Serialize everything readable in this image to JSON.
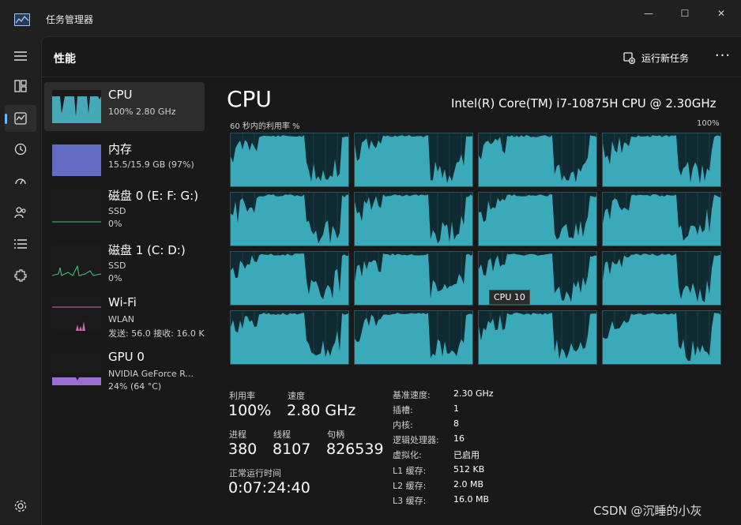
{
  "window": {
    "title": "任务管理器",
    "minimize_glyph": "—",
    "maximize_glyph": "☐",
    "close_glyph": "✕"
  },
  "nav": {
    "items": [
      "menu-icon",
      "processes-icon",
      "performance-icon",
      "app-history-icon",
      "startup-icon",
      "users-icon",
      "details-icon",
      "services-icon",
      "settings-icon"
    ],
    "active": "performance-icon"
  },
  "header": {
    "title": "性能",
    "run_task_label": "运行新任务",
    "more_label": "···"
  },
  "devices": [
    {
      "name": "CPU",
      "line1": "100% 2.80 GHz",
      "line2": "",
      "color": "#4fc3d4"
    },
    {
      "name": "内存",
      "line1": "15.5/15.9 GB (97%)",
      "line2": "",
      "color": "#6b75d6"
    },
    {
      "name": "磁盘 0 (E: F: G:)",
      "line1": "SSD",
      "line2": "0%",
      "color": "#44c37f"
    },
    {
      "name": "磁盘 1 (C: D:)",
      "line1": "SSD",
      "line2": "0%",
      "color": "#44c37f"
    },
    {
      "name": "Wi-Fi",
      "line1": "WLAN",
      "line2": "发送: 56.0 接收: 16.0 K",
      "color": "#d36ab8"
    },
    {
      "name": "GPU 0",
      "line1": "NVIDIA GeForce R...",
      "line2": "24% (64 °C)",
      "color": "#9a6fd1"
    }
  ],
  "cpu": {
    "title": "CPU",
    "model": "Intel(R) Core(TM) i7-10875H CPU @ 2.30GHz",
    "graph_label": "60 秒内的利用率 %",
    "graph_max": "100%",
    "tooltip": "CPU 10",
    "stats": {
      "util_label": "利用率",
      "util_value": "100%",
      "speed_label": "速度",
      "speed_value": "2.80 GHz",
      "proc_label": "进程",
      "proc_value": "380",
      "thread_label": "线程",
      "thread_value": "8107",
      "handle_label": "句柄",
      "handle_value": "826539",
      "uptime_label": "正常运行时间",
      "uptime_value": "0:07:24:40"
    },
    "details": [
      {
        "k": "基准速度:",
        "v": "2.30 GHz"
      },
      {
        "k": "插槽:",
        "v": "1"
      },
      {
        "k": "内核:",
        "v": "8"
      },
      {
        "k": "逻辑处理器:",
        "v": "16"
      },
      {
        "k": "虚拟化:",
        "v": "已启用"
      },
      {
        "k": "L1 缓存:",
        "v": "512 KB"
      },
      {
        "k": "L2 缓存:",
        "v": "2.0 MB"
      },
      {
        "k": "L3 缓存:",
        "v": "16.0 MB"
      }
    ]
  },
  "watermark": "CSDN @沉睡的小灰"
}
